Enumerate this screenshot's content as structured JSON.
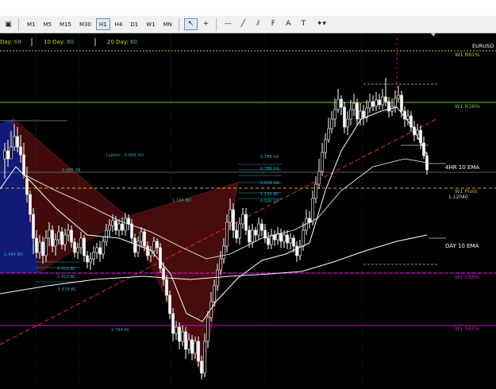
{
  "toolbar": {
    "timeframes": [
      "M1",
      "M5",
      "M15",
      "M30",
      "H1",
      "H4",
      "D1",
      "W1",
      "MN"
    ],
    "active_timeframe": "H1",
    "tools": [
      {
        "icon": "cursor-icon",
        "glyph": "↖"
      },
      {
        "icon": "crosshair-icon",
        "glyph": "+"
      },
      {
        "icon": "horizontal-line-icon",
        "glyph": "—"
      },
      {
        "icon": "trendline-icon",
        "glyph": "╱"
      },
      {
        "icon": "equidistant-channel-icon",
        "glyph": "⫽"
      },
      {
        "icon": "fibonacci-icon",
        "glyph": "F"
      },
      {
        "icon": "text-icon",
        "glyph": "A"
      },
      {
        "icon": "label-icon",
        "glyph": "T"
      },
      {
        "icon": "shapes-dropdown-icon",
        "glyph": "✦▾"
      }
    ]
  },
  "chart": {
    "range_labels": [
      {
        "label": "Day: ",
        "value": "68"
      },
      {
        "label": "10 Day: ",
        "value": "80"
      },
      {
        "label": "20 Day: ",
        "value": "80"
      }
    ],
    "symbol": "EURUSD",
    "level_labels": {
      "r61": "W1 R61%",
      "r38": "W1 R38%",
      "pivot": "W1 Pivot",
      "s38": "W1 S38%",
      "s61": "W1 S61%"
    },
    "ema_labels": {
      "hr4": "4HR 10 EMA",
      "day": "DAY 10 EMA"
    },
    "price_label": "1.12040",
    "annotations": {
      "cypher": "Cypher - 0.606 XD",
      "xb": "0.385 XB",
      "bd_left": "1.494 BD",
      "bd_mid": "1.184 BD",
      "bc_a": "0.410 BC",
      "bc_b": "1.410 BC",
      "bc_c": "1.618 BC",
      "xa_a": "0.786 XA",
      "xa_b": "0.786 XA",
      "xa_c": "0.618 XA",
      "xa_d": "0.500 XA",
      "bc_d": "1.130 BC",
      "ac": "2.744 AC"
    },
    "colors": {
      "bull": "#ffffff",
      "bear": "#ffffff",
      "ema_hr4": "#ffffff",
      "ema_day": "#ffffff",
      "r61": "#a6d81e",
      "r38": "#78c828",
      "pivot": "#d2b414",
      "s38": "#e600e6",
      "s61": "#c814c8",
      "trend": "#e0301e",
      "fib": "#2aaabb",
      "harmonic_red": "#781414",
      "harmonic_blue": "#141e8c"
    }
  }
}
